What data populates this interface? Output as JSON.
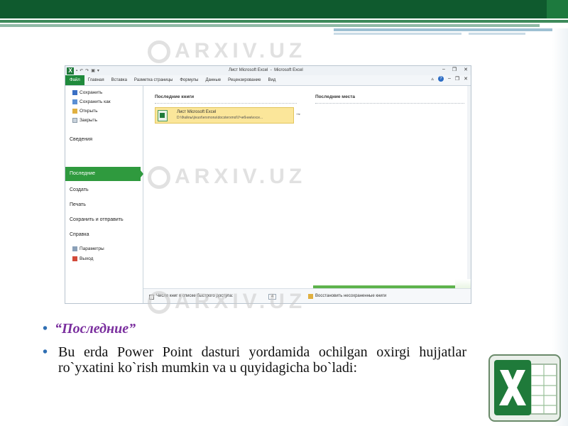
{
  "excel": {
    "qat_icons": [
      "excel-icon",
      "undo-icon",
      "redo-icon",
      "print-icon"
    ],
    "window_title_left": "Лист Microsoft Excel",
    "window_title_right": "Microsoft Excel",
    "tabs": [
      "Файл",
      "Главная",
      "Вставка",
      "Разметка страницы",
      "Формулы",
      "Данные",
      "Рецензирование",
      "Вид"
    ],
    "backstage": {
      "save": "Сохранить",
      "save_as": "Сохранить как",
      "open": "Открыть",
      "close": "Закрыть",
      "info": "Сведения",
      "recent": "Последние",
      "new": "Создать",
      "print": "Печать",
      "send": "Сохранить и отправить",
      "help": "Справка",
      "options": "Параметры",
      "exit": "Выход"
    },
    "recent_books_title": "Последние книги",
    "recent_places_title": "Последние места",
    "recent_file": {
      "name": "Лист Microsoft Excel",
      "path": "D:\\Файлы\\jivuot\\erxmona\\docsterxmol\\Учебник\\exce..."
    },
    "quick_access_label": "Число книг в списке быстрого доступа:",
    "quick_access_count": "4",
    "restore_label": "Восстановить несохраненные книги"
  },
  "watermark": "ARXIV.UZ",
  "slide": {
    "bullet1": "“Последние”",
    "bullet2": "Bu erda Power Point dasturi yordamida ochilgan oxirgi hujjatlar ro`yxatini ko`rish mumkin va u quyidagicha bo`ladi:"
  },
  "colors": {
    "excel_green": "#1f7a3a",
    "bullet_purple": "#7a2e9e",
    "bullet_dot": "#2f6fb3"
  }
}
